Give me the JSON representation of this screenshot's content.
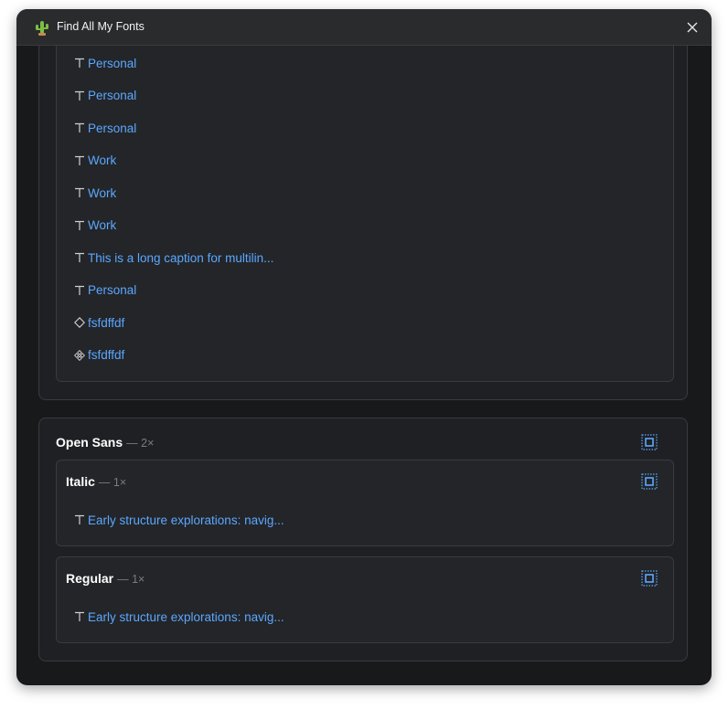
{
  "window": {
    "title": "Find All My Fonts"
  },
  "top_group": {
    "items": [
      {
        "icon": "text-icon",
        "label": "Personal"
      },
      {
        "icon": "text-icon",
        "label": "Personal"
      },
      {
        "icon": "text-icon",
        "label": "Personal"
      },
      {
        "icon": "text-icon",
        "label": "Work"
      },
      {
        "icon": "text-icon",
        "label": "Work"
      },
      {
        "icon": "text-icon",
        "label": "Work"
      },
      {
        "icon": "text-icon",
        "label": "This is a long caption for multilin..."
      },
      {
        "icon": "text-icon",
        "label": "Personal"
      },
      {
        "icon": "component-instance-icon",
        "label": "fsfdffdf"
      },
      {
        "icon": "component-icon",
        "label": "fsfdffdf"
      }
    ]
  },
  "font_group": {
    "name": "Open Sans",
    "count": "— 2×",
    "styles": [
      {
        "name": "Italic",
        "count": "— 1×",
        "items": [
          {
            "icon": "text-icon",
            "label": "Early structure explorations: navig..."
          }
        ]
      },
      {
        "name": "Regular",
        "count": "— 1×",
        "items": [
          {
            "icon": "text-icon",
            "label": "Early structure explorations: navig..."
          }
        ]
      }
    ]
  },
  "colors": {
    "link": "#5ca7ff",
    "window_bg": "#18191b",
    "card_bg": "#1f2023",
    "accent_icon": "#5ca7ff"
  }
}
